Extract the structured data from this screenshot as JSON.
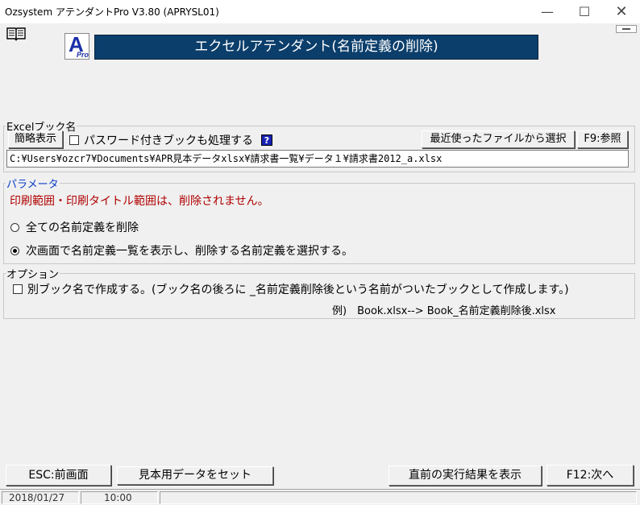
{
  "window": {
    "title": "Ozsystem アテンダントPro V3.80 (APRYSL01)",
    "min": "—",
    "max": "☐",
    "close": "✕"
  },
  "logo": {
    "letter": "A",
    "sub": "Pro"
  },
  "banner": "エクセルアテンダント(名前定義の削除)",
  "excel": {
    "legend": "Excelブック名",
    "summary_btn": "簡略表示",
    "password_label": "パスワード付きブックも処理する",
    "help": "?",
    "recent_btn": "最近使ったファイルから選択",
    "browse_btn": "F9:参照",
    "path": "C:¥Users¥ozcr7¥Documents¥APR見本データxlsx¥請求書一覧¥データ１¥請求書2012_a.xlsx"
  },
  "params": {
    "legend": "パラメータ",
    "warning": "印刷範囲・印刷タイトル範囲は、削除されません。",
    "option_all": "全ての名前定義を削除",
    "option_select": "次画面で名前定義一覧を表示し、削除する名前定義を選択する。",
    "selected": "select"
  },
  "options": {
    "legend": "オプション",
    "separate_label": "別ブック名で作成する。(ブック名の後ろに _名前定義削除後という名前がついたブックとして作成します。)",
    "example": "例)　Book.xlsx--> Book_名前定義削除後.xlsx"
  },
  "footer": {
    "esc_btn": "ESC:前画面",
    "sample_btn": "見本用データをセット",
    "last_result_btn": "直前の実行結果を表示",
    "next_btn": "F12:次へ"
  },
  "status": {
    "date": "2018/01/27",
    "time": "10:00"
  },
  "colors": {
    "banner": "#0b3e6b",
    "param_legend": "#0a3cc8",
    "warning": "#b00000",
    "help_bg": "#1a23b5"
  }
}
